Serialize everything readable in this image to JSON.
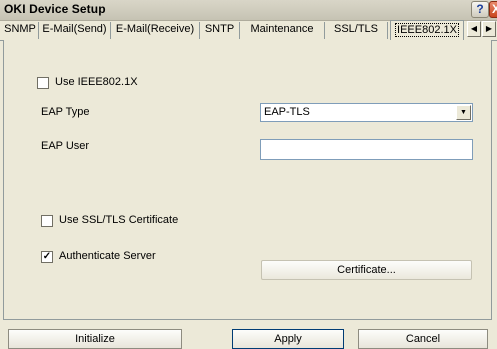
{
  "window": {
    "title": "OKI Device Setup",
    "help_label": "?",
    "close_label": "X"
  },
  "tabs": [
    {
      "label": "SNMP"
    },
    {
      "label": "E-Mail(Send)"
    },
    {
      "label": "E-Mail(Receive)"
    },
    {
      "label": "SNTP"
    },
    {
      "label": "Maintenance"
    },
    {
      "label": "SSL/TLS"
    },
    {
      "label": "IEEE802.1X",
      "active": true
    }
  ],
  "tab_scroll": {
    "left_glyph": "◀",
    "right_glyph": "▶"
  },
  "panel": {
    "use_ieee8021x": {
      "label": "Use IEEE802.1X",
      "checked": false,
      "mark": ""
    },
    "eap_type": {
      "label": "EAP Type",
      "value": "EAP-TLS",
      "arrow_glyph": "▼"
    },
    "eap_user": {
      "label": "EAP User",
      "value": ""
    },
    "use_ssl_cert": {
      "label": "Use SSL/TLS Certificate",
      "checked": false,
      "mark": ""
    },
    "authenticate_server": {
      "label": "Authenticate Server",
      "checked": true,
      "mark": "✓"
    },
    "certificate_button": "Certificate..."
  },
  "buttons": {
    "initialize": "Initialize",
    "apply": "Apply",
    "cancel": "Cancel"
  },
  "colors": {
    "dialog_face": "#ECE9D8",
    "input_border": "#7f9db9",
    "tab_border": "#919b9c"
  }
}
